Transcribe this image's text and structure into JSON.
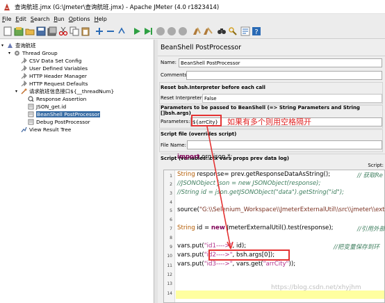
{
  "window": {
    "title": "查询航班.jmx (G:\\Jmeter\\查询航班.jmx) - Apache JMeter (4.0 r1823414)"
  },
  "menu": [
    "File",
    "Edit",
    "Search",
    "Run",
    "Options",
    "Help"
  ],
  "menu_mnemonics": [
    "F",
    "E",
    "S",
    "R",
    "O",
    "H"
  ],
  "tree": {
    "items": [
      {
        "label": "查询航班",
        "icon": "test-plan-icon"
      },
      {
        "label": "Thread Group",
        "icon": "thread-group-icon"
      },
      {
        "label": "CSV Data Set Config",
        "icon": "config-icon"
      },
      {
        "label": "User Defined Variables",
        "icon": "config-icon"
      },
      {
        "label": "HTTP Header Manager",
        "icon": "config-icon"
      },
      {
        "label": "HTTP Request Defaults",
        "icon": "config-icon"
      },
      {
        "label": "请求航班信息接口${__threadNum}",
        "icon": "sampler-icon"
      },
      {
        "label": "Response Assertion",
        "icon": "assertion-icon"
      },
      {
        "label": "JSON_get.id",
        "icon": "extractor-icon"
      },
      {
        "label": "BeanShell PostProcessor",
        "icon": "postprocessor-icon"
      },
      {
        "label": "Debug PostProcessor",
        "icon": "postprocessor-icon"
      },
      {
        "label": "View Result Tree",
        "icon": "listener-icon"
      }
    ]
  },
  "panel": {
    "title": "BeanShell PostProcessor",
    "name_label": "Name:",
    "name_value": "BeanShell PostProcessor",
    "comments_label": "Comments:",
    "comments_value": "",
    "reset_section": "Reset bsh.Interpreter before each call",
    "reset_label": "Reset Interpreter:",
    "reset_value": "False",
    "params_section": "Parameters to be passed to BeanShell (=> String Parameters and String []bsh.args)",
    "params_label": "Parameters:",
    "params_value": "${arrCity}",
    "file_section": "Script file (overrides script)",
    "file_label": "File Name:",
    "file_value": "",
    "script_section": "Script (variables: ctx vars props prev data log)",
    "script_label": "Script:"
  },
  "annotation": {
    "text": "如果有多个则用空格隔开"
  },
  "code": {
    "line_numbers": [
      "1",
      "2",
      "3",
      "4",
      "5",
      "6",
      "7",
      "8",
      "9",
      "10",
      "11",
      "12",
      "13",
      "14"
    ],
    "l1_kw": "import",
    "l1_rest": " org.json.*;",
    "l3_type": "String",
    "l3_rest": " response= prev.getResponseDataAsString();",
    "l3_comment": "// 获取Re",
    "l4": "//JSONObject json = new JSONObject(response);",
    "l5": "//String id = json.getJSONObject(\"data\").getString(\"id\");",
    "l7_a": "source(",
    "l7_str": "\"G:\\\\Selenium_Workspace\\\\JmeterExternalUtil\\\\src\\\\jmeter\\\\external\\\\",
    "l9_type": "String",
    "l9_mid": " id = ",
    "l9_kw": "new",
    "l9_rest": " JmeterExternalUtil().test(response);",
    "l9_comment": "//引用外部",
    "l11_a": "vars.put(",
    "l11_str": "\"id1---->\"",
    "l11_b": ", id);",
    "l11_comment": "//把变量保存到环",
    "l12_a": "vars.put(",
    "l12_str": "\"id2---->\"",
    "l12_b": ", bsh.args[0]);",
    "l13_a": "vars.put(",
    "l13_str": "\"id3---->\"",
    "l13_b": ", vars.get(",
    "l13_str2": "\"arrCity\"",
    "l13_c": "));"
  },
  "watermark": "https://blog.csdn.net/xhyjhm",
  "colors": {
    "selection": "#3a6ea5",
    "annotation": "#e02020",
    "keyword": "#7f0055",
    "string": "#2a00ff",
    "comment": "#3f7f5f"
  }
}
